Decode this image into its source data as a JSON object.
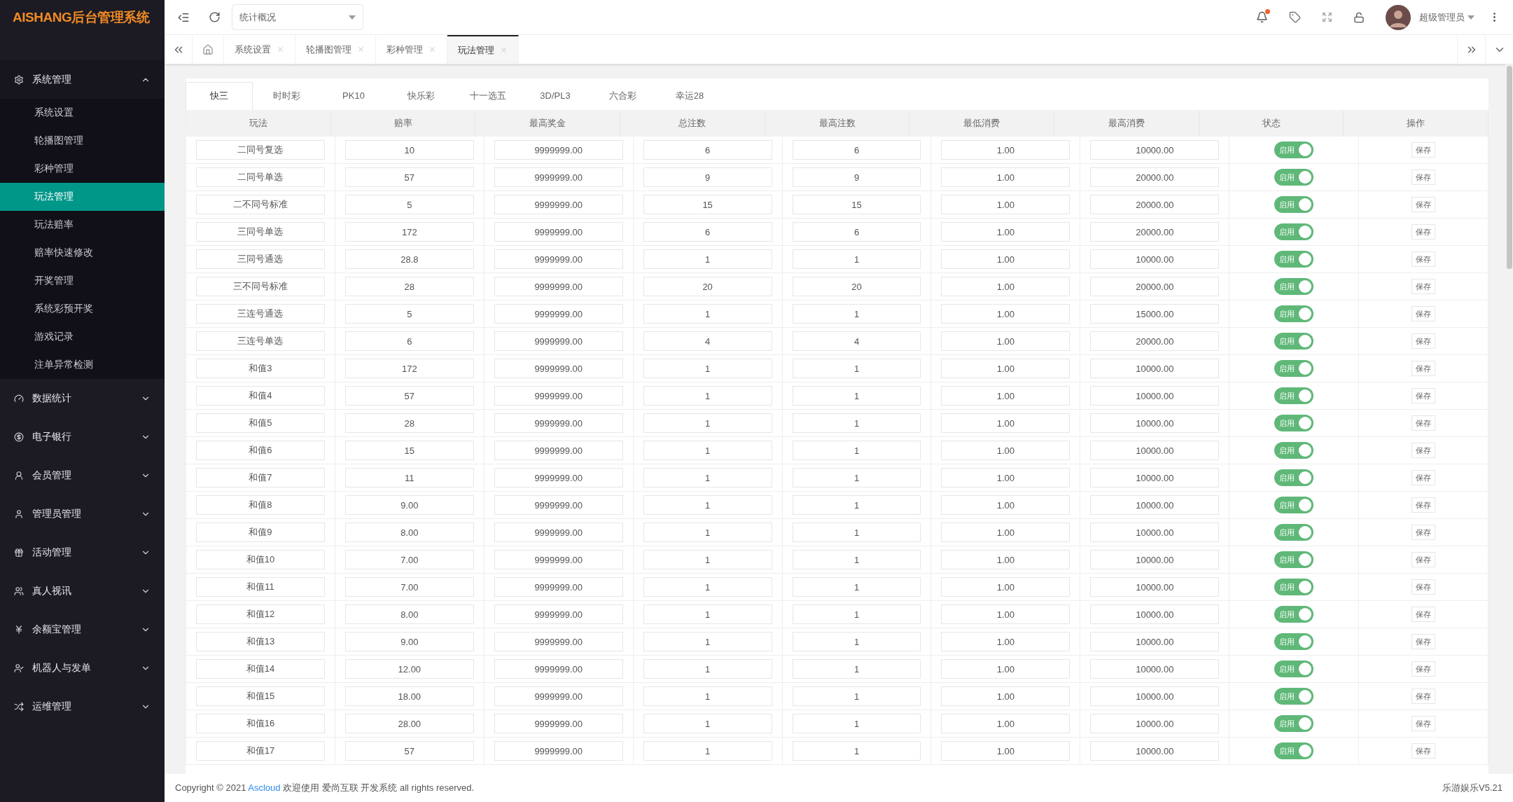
{
  "logo": "AISHANG后台管理系统",
  "sidebar": {
    "groups": [
      {
        "label": "系统管理",
        "expanded": true,
        "children": [
          {
            "label": "系统设置",
            "selected": false
          },
          {
            "label": "轮播图管理",
            "selected": false
          },
          {
            "label": "彩种管理",
            "selected": false
          },
          {
            "label": "玩法管理",
            "selected": true
          },
          {
            "label": "玩法赔率",
            "selected": false
          },
          {
            "label": "赔率快速修改",
            "selected": false
          },
          {
            "label": "开奖管理",
            "selected": false
          },
          {
            "label": "系统彩预开奖",
            "selected": false
          },
          {
            "label": "游戏记录",
            "selected": false
          },
          {
            "label": "注单异常检测",
            "selected": false
          }
        ]
      },
      {
        "label": "数据统计",
        "expanded": false
      },
      {
        "label": "电子银行",
        "expanded": false
      },
      {
        "label": "会员管理",
        "expanded": false
      },
      {
        "label": "管理员管理",
        "expanded": false
      },
      {
        "label": "活动管理",
        "expanded": false
      },
      {
        "label": "真人视讯",
        "expanded": false
      },
      {
        "label": "余额宝管理",
        "expanded": false
      },
      {
        "label": "机器人与发单",
        "expanded": false
      },
      {
        "label": "运维管理",
        "expanded": false
      }
    ]
  },
  "header": {
    "select": "统计概况",
    "notification_dot": true,
    "user": "超级管理员"
  },
  "page_tabs": [
    {
      "label": "系统设置",
      "selected": false
    },
    {
      "label": "轮播图管理",
      "selected": false
    },
    {
      "label": "彩种管理",
      "selected": false
    },
    {
      "label": "玩法管理",
      "selected": true
    }
  ],
  "lottery_tabs": [
    {
      "label": "快三",
      "selected": true
    },
    {
      "label": "时时彩",
      "selected": false
    },
    {
      "label": "PK10",
      "selected": false
    },
    {
      "label": "快乐彩",
      "selected": false
    },
    {
      "label": "十一选五",
      "selected": false
    },
    {
      "label": "3D/PL3",
      "selected": false
    },
    {
      "label": "六合彩",
      "selected": false
    },
    {
      "label": "幸运28",
      "selected": false
    }
  ],
  "table": {
    "columns": [
      "玩法",
      "赔率",
      "最高奖金",
      "总注数",
      "最高注数",
      "最低消费",
      "最高消费",
      "状态",
      "操作"
    ],
    "rows": [
      {
        "cells": [
          "二同号复选",
          "10",
          "9999999.00",
          "6",
          "6",
          "1.00",
          "10000.00"
        ],
        "status": {
          "label": "启用",
          "on": true
        },
        "action": "保存"
      },
      {
        "cells": [
          "二同号单选",
          "57",
          "9999999.00",
          "9",
          "9",
          "1.00",
          "20000.00"
        ],
        "status": {
          "label": "启用",
          "on": true
        },
        "action": "保存"
      },
      {
        "cells": [
          "二不同号标准",
          "5",
          "9999999.00",
          "15",
          "15",
          "1.00",
          "20000.00"
        ],
        "status": {
          "label": "启用",
          "on": true
        },
        "action": "保存"
      },
      {
        "cells": [
          "三同号单选",
          "172",
          "9999999.00",
          "6",
          "6",
          "1.00",
          "20000.00"
        ],
        "status": {
          "label": "启用",
          "on": true
        },
        "action": "保存"
      },
      {
        "cells": [
          "三同号通选",
          "28.8",
          "9999999.00",
          "1",
          "1",
          "1.00",
          "10000.00"
        ],
        "status": {
          "label": "启用",
          "on": true
        },
        "action": "保存"
      },
      {
        "cells": [
          "三不同号标准",
          "28",
          "9999999.00",
          "20",
          "20",
          "1.00",
          "20000.00"
        ],
        "status": {
          "label": "启用",
          "on": true
        },
        "action": "保存"
      },
      {
        "cells": [
          "三连号通选",
          "5",
          "9999999.00",
          "1",
          "1",
          "1.00",
          "15000.00"
        ],
        "status": {
          "label": "启用",
          "on": true
        },
        "action": "保存"
      },
      {
        "cells": [
          "三连号单选",
          "6",
          "9999999.00",
          "4",
          "4",
          "1.00",
          "20000.00"
        ],
        "status": {
          "label": "启用",
          "on": true
        },
        "action": "保存"
      },
      {
        "cells": [
          "和值3",
          "172",
          "9999999.00",
          "1",
          "1",
          "1.00",
          "10000.00"
        ],
        "status": {
          "label": "启用",
          "on": true
        },
        "action": "保存"
      },
      {
        "cells": [
          "和值4",
          "57",
          "9999999.00",
          "1",
          "1",
          "1.00",
          "10000.00"
        ],
        "status": {
          "label": "启用",
          "on": true
        },
        "action": "保存"
      },
      {
        "cells": [
          "和值5",
          "28",
          "9999999.00",
          "1",
          "1",
          "1.00",
          "10000.00"
        ],
        "status": {
          "label": "启用",
          "on": true
        },
        "action": "保存"
      },
      {
        "cells": [
          "和值6",
          "15",
          "9999999.00",
          "1",
          "1",
          "1.00",
          "10000.00"
        ],
        "status": {
          "label": "启用",
          "on": true
        },
        "action": "保存"
      },
      {
        "cells": [
          "和值7",
          "11",
          "9999999.00",
          "1",
          "1",
          "1.00",
          "10000.00"
        ],
        "status": {
          "label": "启用",
          "on": true
        },
        "action": "保存"
      },
      {
        "cells": [
          "和值8",
          "9.00",
          "9999999.00",
          "1",
          "1",
          "1.00",
          "10000.00"
        ],
        "status": {
          "label": "启用",
          "on": true
        },
        "action": "保存"
      },
      {
        "cells": [
          "和值9",
          "8.00",
          "9999999.00",
          "1",
          "1",
          "1.00",
          "10000.00"
        ],
        "status": {
          "label": "启用",
          "on": true
        },
        "action": "保存"
      },
      {
        "cells": [
          "和值10",
          "7.00",
          "9999999.00",
          "1",
          "1",
          "1.00",
          "10000.00"
        ],
        "status": {
          "label": "启用",
          "on": true
        },
        "action": "保存"
      },
      {
        "cells": [
          "和值11",
          "7.00",
          "9999999.00",
          "1",
          "1",
          "1.00",
          "10000.00"
        ],
        "status": {
          "label": "启用",
          "on": true
        },
        "action": "保存"
      },
      {
        "cells": [
          "和值12",
          "8.00",
          "9999999.00",
          "1",
          "1",
          "1.00",
          "10000.00"
        ],
        "status": {
          "label": "启用",
          "on": true
        },
        "action": "保存"
      },
      {
        "cells": [
          "和值13",
          "9.00",
          "9999999.00",
          "1",
          "1",
          "1.00",
          "10000.00"
        ],
        "status": {
          "label": "启用",
          "on": true
        },
        "action": "保存"
      },
      {
        "cells": [
          "和值14",
          "12.00",
          "9999999.00",
          "1",
          "1",
          "1.00",
          "10000.00"
        ],
        "status": {
          "label": "启用",
          "on": true
        },
        "action": "保存"
      },
      {
        "cells": [
          "和值15",
          "18.00",
          "9999999.00",
          "1",
          "1",
          "1.00",
          "10000.00"
        ],
        "status": {
          "label": "启用",
          "on": true
        },
        "action": "保存"
      },
      {
        "cells": [
          "和值16",
          "28.00",
          "9999999.00",
          "1",
          "1",
          "1.00",
          "10000.00"
        ],
        "status": {
          "label": "启用",
          "on": true
        },
        "action": "保存"
      },
      {
        "cells": [
          "和值17",
          "57",
          "9999999.00",
          "1",
          "1",
          "1.00",
          "10000.00"
        ],
        "status": {
          "label": "启用",
          "on": true
        },
        "action": "保存"
      }
    ]
  },
  "footer": {
    "copyright_before": "Copyright © 2021 ",
    "copyright_link": "Ascloud",
    "copyright_after": " 欢迎使用 爱尚互联 开发系统 all rights reserved.",
    "version": "乐游娱乐V5.21"
  }
}
